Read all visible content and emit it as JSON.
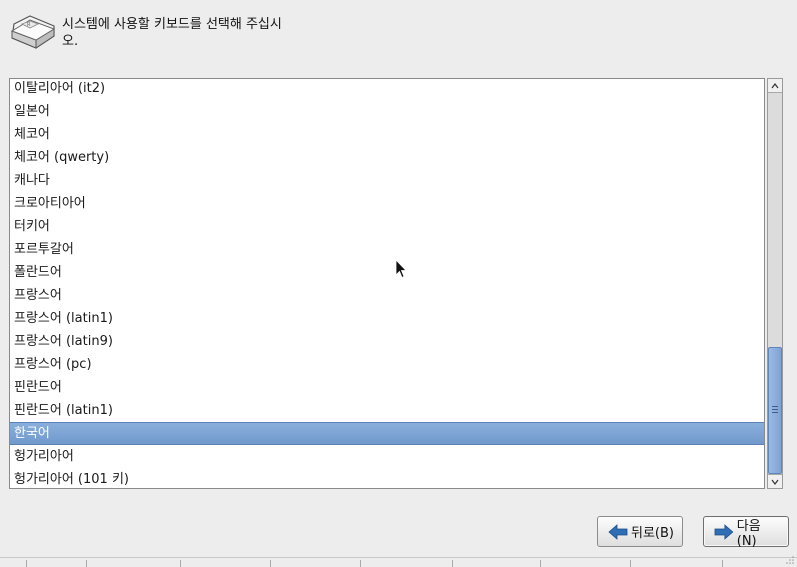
{
  "header": {
    "icon": "keyboard-icon",
    "prompt_line1": "시스템에 사용할 키보드를 선택해 주십시",
    "prompt_line2": "오."
  },
  "keyboard_list": {
    "items": [
      "이탈리아어 (it2)",
      "일본어",
      "체코어",
      "체코어 (qwerty)",
      "캐나다",
      "크로아티아어",
      "터키어",
      "포르투갈어",
      "폴란드어",
      "프랑스어",
      "프랑스어 (latin1)",
      "프랑스어 (latin9)",
      "프랑스어 (pc)",
      "핀란드어",
      "핀란드어 (latin1)",
      "한국어",
      "헝가리아어",
      "헝가리아어 (101 키)"
    ],
    "selected": "한국어",
    "selection_color": "#7ea5d6"
  },
  "scrollbar": {
    "position_fraction": 0.67
  },
  "buttons": {
    "back_label": "뒤로(B)",
    "next_label": "다음(N)",
    "arrow_color": "#2f6db5"
  }
}
